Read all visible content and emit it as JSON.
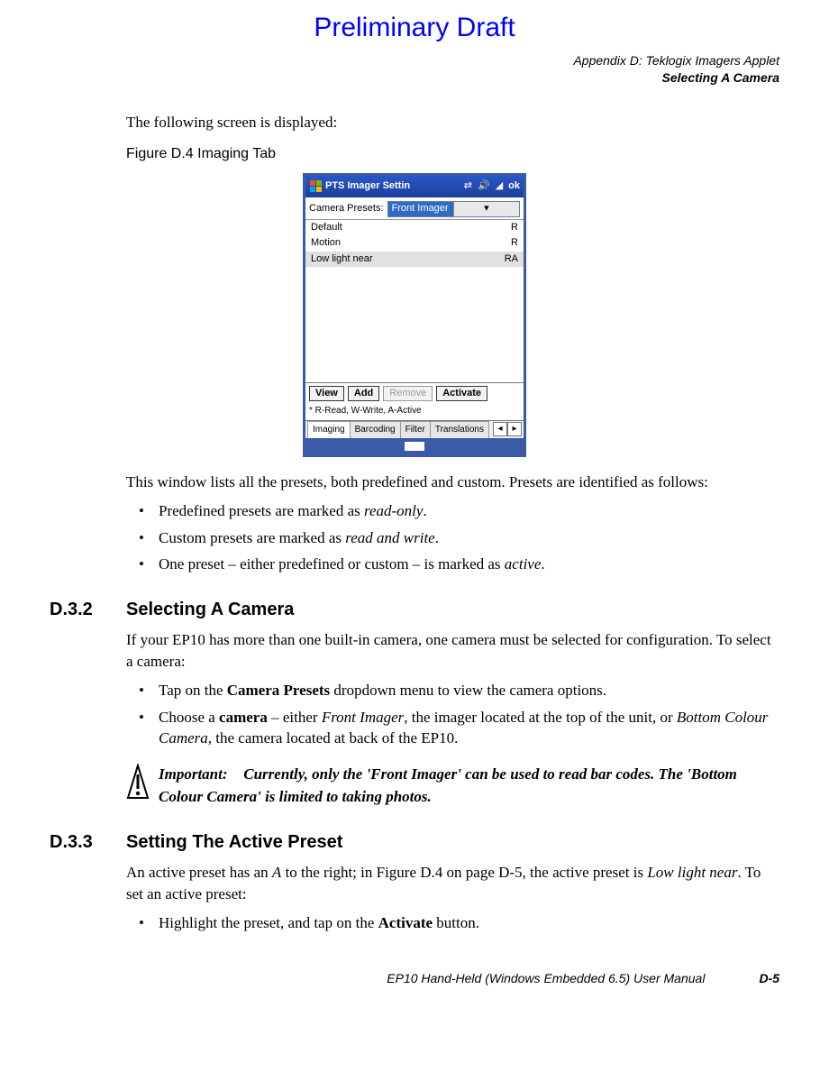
{
  "watermark": "Preliminary Draft",
  "header": {
    "line1": "Appendix D: Teklogix Imagers Applet",
    "line2": "Selecting A Camera"
  },
  "intro_text": "The following screen is displayed:",
  "figure_caption": "Figure D.4  Imaging Tab",
  "device": {
    "titlebar": {
      "title": "PTS Imager Settin",
      "ok": "ok"
    },
    "camera_label": "Camera Presets:",
    "camera_value": "Front Imager",
    "presets": [
      {
        "name": "Default",
        "flags": "R",
        "selected": false
      },
      {
        "name": "Motion",
        "flags": "R",
        "selected": false
      },
      {
        "name": "Low light near",
        "flags": "RA",
        "selected": true
      }
    ],
    "buttons": {
      "view": "View",
      "add": "Add",
      "remove": "Remove",
      "activate": "Activate"
    },
    "legend": "* R-Read, W-Write, A-Active",
    "tabs": [
      "Imaging",
      "Barcoding",
      "Filter",
      "Translations"
    ],
    "active_tab_index": 0
  },
  "after_figure_p1": "This window lists all the presets, both predefined and custom. Presets are identified as follows:",
  "bullets1": [
    {
      "pre": "Predefined presets are marked as ",
      "em": "read-only",
      "post": "."
    },
    {
      "pre": "Custom presets are marked as ",
      "em": "read and write",
      "post": "."
    },
    {
      "pre": "One preset – either predefined or custom – is marked as ",
      "em": "active",
      "post": "."
    }
  ],
  "section_d32": {
    "num": "D.3.2",
    "title": "Selecting A Camera",
    "p1": "If your EP10 has more than one built-in camera, one camera must be selected for configuration. To select a camera:",
    "bullets": [
      {
        "parts": [
          {
            "t": "Tap on the "
          },
          {
            "t": "Camera Presets",
            "bold": true
          },
          {
            "t": " dropdown menu to view the camera options."
          }
        ]
      },
      {
        "parts": [
          {
            "t": "Choose a "
          },
          {
            "t": "camera",
            "bold": true
          },
          {
            "t": " – either "
          },
          {
            "t": "Front Imager",
            "italic": true
          },
          {
            "t": ", the imager located at the top of the unit, or "
          },
          {
            "t": "Bottom Colour Camera",
            "italic": true
          },
          {
            "t": ", the camera located at back of the EP10."
          }
        ]
      }
    ]
  },
  "important": {
    "label": "Important:",
    "text": "Currently, only the 'Front Imager' can be used to read bar codes. The 'Bottom Colour Camera' is limited to taking photos."
  },
  "section_d33": {
    "num": "D.3.3",
    "title": "Setting The Active Preset",
    "p1_parts": [
      {
        "t": "An active preset has an "
      },
      {
        "t": "A",
        "italic": true
      },
      {
        "t": " to the right; in Figure D.4 on page D-5, the active preset is "
      },
      {
        "t": "Low light near",
        "italic": true
      },
      {
        "t": ". To set an active preset:"
      }
    ],
    "bullets": [
      {
        "parts": [
          {
            "t": "Highlight the preset, and tap on the "
          },
          {
            "t": "Activate",
            "bold": true
          },
          {
            "t": " button."
          }
        ]
      }
    ]
  },
  "footer": {
    "manual": "EP10 Hand-Held (Windows Embedded 6.5) User Manual",
    "page": "D-5"
  }
}
